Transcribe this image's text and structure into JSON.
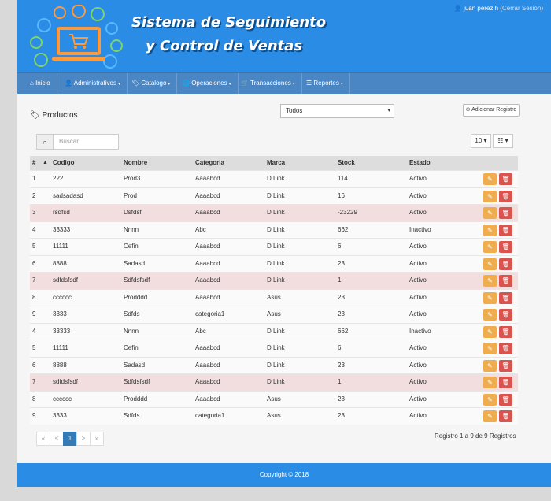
{
  "header": {
    "title_line1": "Sistema de Seguimiento",
    "title_line2": "y Control de Ventas",
    "user_name": "juan perez h",
    "logout_label": "Cerrar Sesión"
  },
  "nav": [
    {
      "label": "Inicio",
      "icon": "home-icon"
    },
    {
      "label": "Administrativos",
      "icon": "user-icon"
    },
    {
      "label": "Catalogo",
      "icon": "tag-icon"
    },
    {
      "label": "Operaciones",
      "icon": "globe-icon"
    },
    {
      "label": "Transacciones",
      "icon": "cart-icon"
    },
    {
      "label": "Reportes",
      "icon": "list-icon"
    }
  ],
  "page": {
    "title": "Productos",
    "filter_value": "Todos",
    "add_label": "Adicionar Registro",
    "search_placeholder": "Buscar",
    "page_size": "10",
    "columns": [
      "#",
      "Codigo",
      "Nombre",
      "Categoria",
      "Marca",
      "Stock",
      "Estado"
    ],
    "rows": [
      [
        "1",
        "222",
        "Prod3",
        "Aaaabcd",
        "D Link",
        "114",
        "Activo"
      ],
      [
        "2",
        "sadsadasd",
        "Prod",
        "Aaaabcd",
        "D Link",
        "16",
        "Activo"
      ],
      [
        "3",
        "rsdfsd",
        "Dsfdsf",
        "Aaaabcd",
        "D Link",
        "-23229",
        "Activo"
      ],
      [
        "4",
        "33333",
        "Nnnn",
        "Abc",
        "D Link",
        "662",
        "Inactivo"
      ],
      [
        "5",
        "11111",
        "Cefin",
        "Aaaabcd",
        "D Link",
        "6",
        "Activo"
      ],
      [
        "6",
        "8888",
        "Sadasd",
        "Aaaabcd",
        "D Link",
        "23",
        "Activo"
      ],
      [
        "7",
        "sdfdsfsdf",
        "Sdfdsfsdf",
        "Aaaabcd",
        "D Link",
        "1",
        "Activo"
      ],
      [
        "8",
        "cccccc",
        "Prodddd",
        "Aaaabcd",
        "Asus",
        "23",
        "Activo"
      ],
      [
        "9",
        "3333",
        "Sdfds",
        "categoria1",
        "Asus",
        "23",
        "Activo"
      ],
      [
        "4",
        "33333",
        "Nnnn",
        "Abc",
        "D Link",
        "662",
        "Inactivo"
      ],
      [
        "5",
        "11111",
        "Cefin",
        "Aaaabcd",
        "D Link",
        "6",
        "Activo"
      ],
      [
        "6",
        "8888",
        "Sadasd",
        "Aaaabcd",
        "D Link",
        "23",
        "Activo"
      ],
      [
        "7",
        "sdfdsfsdf",
        "Sdfdsfsdf",
        "Aaaabcd",
        "D Link",
        "1",
        "Activo"
      ],
      [
        "8",
        "cccccc",
        "Prodddd",
        "Aaaabcd",
        "Asus",
        "23",
        "Activo"
      ],
      [
        "9",
        "3333",
        "Sdfds",
        "categoria1",
        "Asus",
        "23",
        "Activo"
      ]
    ],
    "danger_rows": [
      2,
      6,
      12
    ],
    "pagination": [
      "«",
      "<",
      "1",
      ">",
      "»"
    ],
    "record_info": "Registro 1 a 9 de 9 Registros"
  },
  "footer": {
    "copyright": "Copyright © 2018"
  },
  "colors": {
    "header": "#2b8ce6",
    "navbar": "#4a85c4",
    "edit": "#f0ad4e",
    "delete": "#d9534f",
    "danger_row": "#f2dede"
  }
}
